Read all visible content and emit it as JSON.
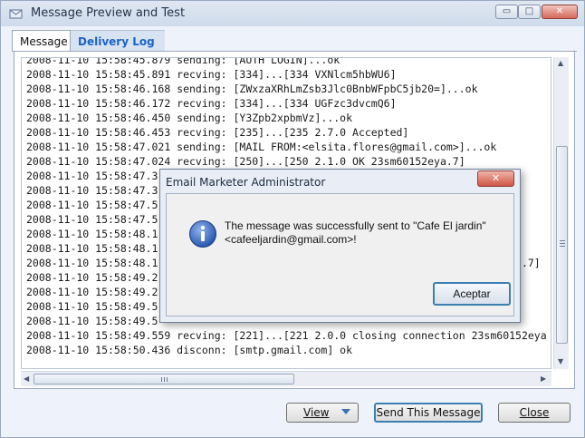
{
  "window": {
    "title": "Message Preview and Test",
    "controls": {
      "minimize": "▭",
      "maximize": "□",
      "close": "✕"
    }
  },
  "tabs": [
    {
      "label": "Message",
      "active": true
    },
    {
      "label": "Delivery Log",
      "active": false
    }
  ],
  "log": [
    "2008-11-10 15:58:45.879 sending: [AUTH LOGIN]...ok",
    "2008-11-10 15:58:45.891 recving: [334]...[334 VXNlcm5hbWU6]",
    "2008-11-10 15:58:46.168 sending: [ZWxzaXRhLmZsb3Jlc0BnbWFpbC5jb20=]...ok",
    "2008-11-10 15:58:46.172 recving: [334]...[334 UGFzc3dvcmQ6]",
    "2008-11-10 15:58:46.450 sending: [Y3Zpb2xpbmVz]...ok",
    "2008-11-10 15:58:46.453 recving: [235]...[235 2.7.0 Accepted]",
    "2008-11-10 15:58:47.021 sending: [MAIL FROM:<elsita.flores@gmail.com>]...ok",
    "2008-11-10 15:58:47.024 recving: [250]...[250 2.1.0 OK 23sm60152eya.7]",
    "2008-11-10 15:58:47.3",
    "2008-11-10 15:58:47.3",
    "2008-11-10 15:58:47.5",
    "2008-11-10 15:58:47.5",
    "2008-11-10 15:58:48.1",
    "2008-11-10 15:58:48.1",
    "2008-11-10 15:58:48.1                                                          .7]",
    "2008-11-10 15:58:49.2",
    "2008-11-10 15:58:49.2",
    "2008-11-10 15:58:49.5",
    "2008-11-10 15:58:49.5",
    "2008-11-10 15:58:49.559 recving: [221]...[221 2.0.0 closing connection 23sm60152eya",
    "2008-11-10 15:58:50.436 disconn: [smtp.gmail.com] ok"
  ],
  "buttons": {
    "view": "View",
    "send": "Send This Message",
    "close": "Close"
  },
  "dialog": {
    "title": "Email Marketer Administrator",
    "close": "✕",
    "message_line1": "The message was successfully sent to \"Cafe El jardin\"",
    "message_line2": "<cafeeljardin@gmail.com>!",
    "ok": "Aceptar",
    "icon": "info-icon"
  }
}
